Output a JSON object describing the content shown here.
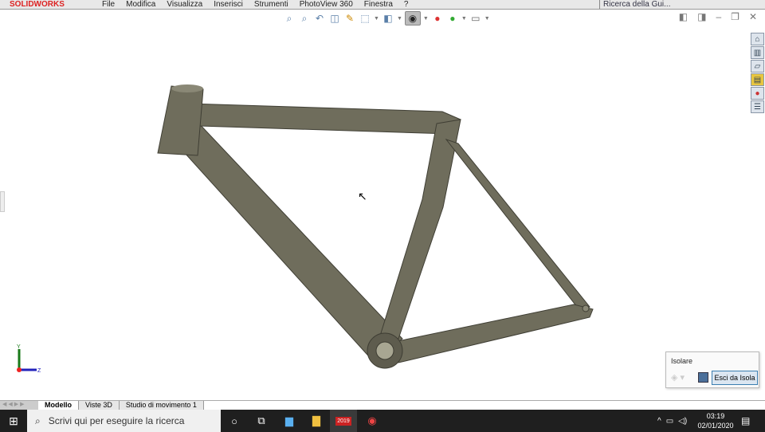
{
  "app": {
    "logo": "SOLIDWORKS",
    "menus": [
      "File",
      "Modifica",
      "Visualizza",
      "Inserisci",
      "Strumenti",
      "PhotoView 360",
      "Finestra",
      "?"
    ],
    "search": "Ricerca della Gui..."
  },
  "toolbar": {
    "icons": [
      "zoom-to-fit-icon",
      "zoom-area-icon",
      "previous-view-icon",
      "section-view-icon",
      "dynamic-annotation-icon",
      "view-orientation-icon",
      "display-style-icon",
      "hide-show-icon",
      "edit-appearance-icon",
      "apply-scene-icon",
      "view-settings-icon"
    ]
  },
  "isolate": {
    "title": "Isolare",
    "exit_label": "Esci da Isola"
  },
  "tabs": [
    "Modello",
    "Viste 3D",
    "Studio di movimento 1"
  ],
  "triad": {
    "y": "Y",
    "z": "Z"
  },
  "taskbar": {
    "search_placeholder": "Scrivi qui per eseguire la ricerca",
    "time": "03:19",
    "date": "02/01/2020",
    "sw_badge": "2019"
  },
  "colors": {
    "frame": "#6f6d5c",
    "accent": "#3c7fb1"
  }
}
